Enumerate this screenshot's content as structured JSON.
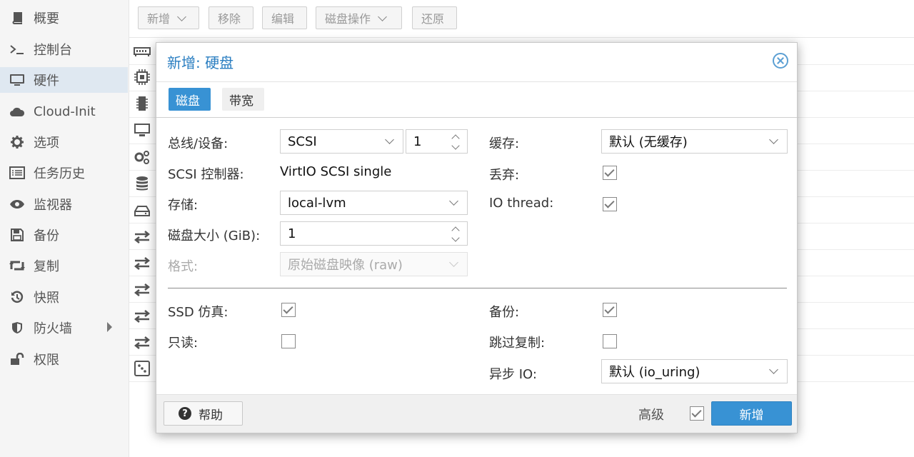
{
  "sidebar": {
    "items": [
      {
        "label": "概要",
        "icon": "book-icon"
      },
      {
        "label": "控制台",
        "icon": "terminal-icon"
      },
      {
        "label": "硬件",
        "icon": "monitor-icon",
        "active": true
      },
      {
        "label": "Cloud-Init",
        "icon": "cloud-icon"
      },
      {
        "label": "选项",
        "icon": "gear-icon"
      },
      {
        "label": "任务历史",
        "icon": "list-icon"
      },
      {
        "label": "监视器",
        "icon": "eye-icon"
      },
      {
        "label": "备份",
        "icon": "floppy-icon"
      },
      {
        "label": "复制",
        "icon": "retweet-icon"
      },
      {
        "label": "快照",
        "icon": "history-icon"
      },
      {
        "label": "防火墙",
        "icon": "shield-icon"
      },
      {
        "label": "权限",
        "icon": "unlock-icon"
      }
    ]
  },
  "toolbar": {
    "add": "新增",
    "remove": "移除",
    "edit": "编辑",
    "disk_action": "磁盘操作",
    "revert": "还原"
  },
  "dialog": {
    "title": "新增: 硬盘",
    "tabs": [
      "磁盘",
      "带宽"
    ],
    "bus_device_label": "总线/设备:",
    "bus_value": "SCSI",
    "device_value": "1",
    "scsi_controller_label": "SCSI 控制器:",
    "scsi_controller_value": "VirtIO SCSI single",
    "storage_label": "存储:",
    "storage_value": "local-lvm",
    "disk_size_label": "磁盘大小 (GiB):",
    "disk_size_value": "1",
    "format_label": "格式:",
    "format_value": "原始磁盘映像 (raw)",
    "cache_label": "缓存:",
    "cache_value": "默认 (无缓存)",
    "discard_label": "丢弃:",
    "discard_checked": true,
    "iothread_label": "IO thread:",
    "iothread_checked": true,
    "ssd_label": "SSD 仿真:",
    "ssd_checked": true,
    "readonly_label": "只读:",
    "readonly_checked": false,
    "backup_label": "备份:",
    "backup_checked": true,
    "skip_replication_label": "跳过复制:",
    "skip_replication_checked": false,
    "async_io_label": "异步 IO:",
    "async_io_value": "默认 (io_uring)",
    "help_button": "帮助",
    "advanced_label": "高级",
    "advanced_checked": true,
    "add_button": "新增"
  },
  "colors": {
    "accent": "#3892d4",
    "title": "#2a7ec1",
    "sidebar_active": "#dfe8f1"
  }
}
